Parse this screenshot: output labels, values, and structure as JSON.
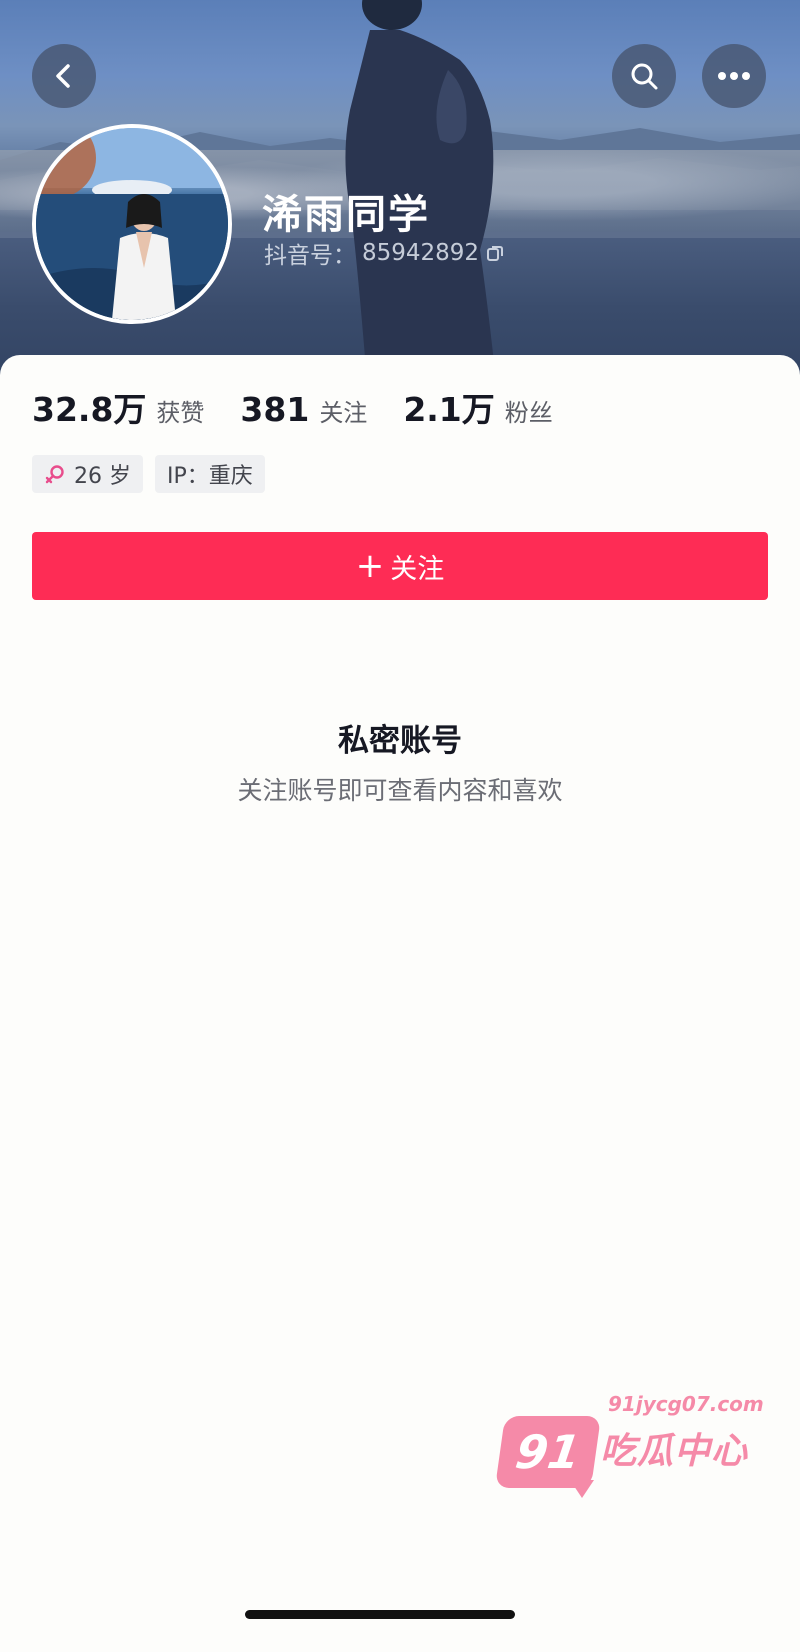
{
  "header": {
    "back_icon": "chevron-left-icon",
    "search_icon": "search-icon",
    "more_icon": "more-horizontal-icon"
  },
  "profile": {
    "name": "浠雨同学",
    "douyin_id_label": "抖音号：",
    "douyin_id": "85942892",
    "copy_icon": "copy-icon"
  },
  "stats": [
    {
      "value": "32.8万",
      "label": "获赞"
    },
    {
      "value": "381",
      "label": "关注"
    },
    {
      "value": "2.1万",
      "label": "粉丝"
    }
  ],
  "tags": {
    "age": "26 岁",
    "ip": "IP：重庆",
    "gender_icon": "female-icon"
  },
  "follow_button": {
    "plus": "+",
    "label": "关注",
    "color": "#fe2c55"
  },
  "private": {
    "title": "私密账号",
    "subtitle": "关注账号即可查看内容和喜欢"
  },
  "watermark": {
    "badge": "91",
    "url": "91jycg07.com",
    "text": "吃瓜中心",
    "color": "#f58aa8"
  }
}
